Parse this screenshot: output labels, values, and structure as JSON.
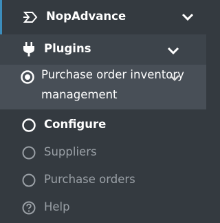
{
  "sidebar": {
    "items": [
      {
        "label": "NopAdvance",
        "icon": "nopadvance-logo-icon",
        "expanded": true
      },
      {
        "label": "Plugins",
        "icon": "plug-icon",
        "expanded": true
      },
      {
        "label_line1": "Purchase order inventory",
        "label_line2": "management",
        "icon": "radio-selected-icon",
        "active": true
      },
      {
        "label": "Configure",
        "icon": "radio-icon"
      },
      {
        "label": "Suppliers",
        "icon": "radio-icon"
      },
      {
        "label": "Purchase orders",
        "icon": "radio-icon"
      },
      {
        "label": "Help",
        "icon": "question-circle-icon"
      }
    ]
  },
  "colors": {
    "sidebar_bg": "#343a40",
    "accent": "#3c8dbc",
    "active_bg": "#484f57",
    "text_active": "#ffffff",
    "text_muted": "#9aa0a6"
  }
}
